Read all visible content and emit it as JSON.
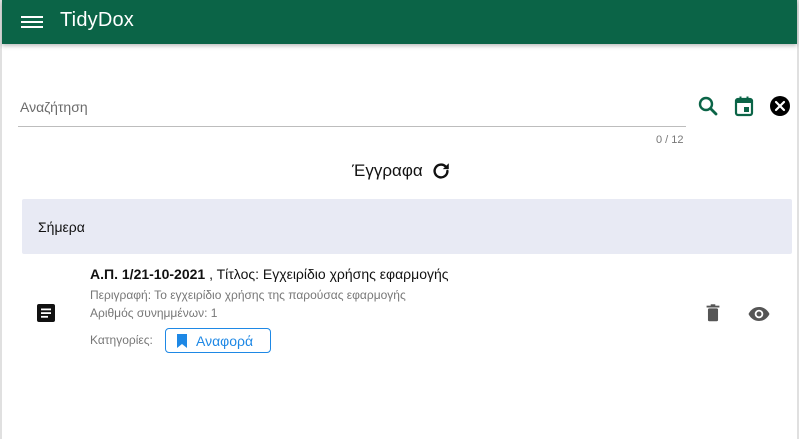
{
  "app": {
    "title": "TidyDox",
    "primary_color": "#0b6447"
  },
  "search": {
    "placeholder": "Αναζήτηση",
    "value": "",
    "counter": "0 / 12",
    "icons": [
      "search-icon",
      "calendar-icon",
      "close-icon"
    ]
  },
  "documents": {
    "heading": "Έγγραφα",
    "refresh_icon": "refresh-icon",
    "groups": [
      {
        "label": "Σήμερα",
        "items": [
          {
            "number": "Α.Π. 1/21-10-2021",
            "title": " , Τίτλος: Εγχειρίδιο χρήσης εφαρμογής",
            "description": "Περιγραφή: Το εγχειρίδιο χρήσης της παρούσας εφαρμογής",
            "attachments": "Αριθμός συνημμένων: 1",
            "categories_label": "Κατηγορίες:",
            "category": "Αναφορά",
            "category_color": "#1e88e5",
            "icons": [
              "document-icon",
              "delete-icon",
              "view-icon"
            ]
          }
        ]
      }
    ]
  }
}
